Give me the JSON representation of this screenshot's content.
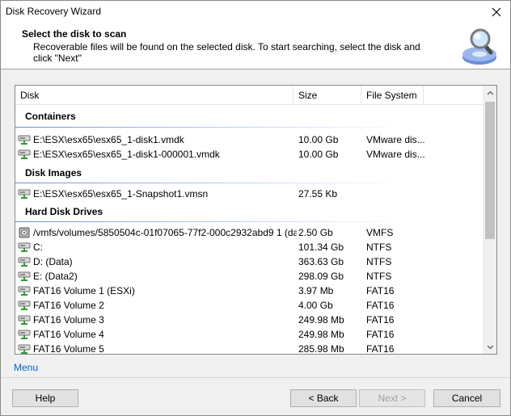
{
  "window": {
    "title": "Disk Recovery Wizard"
  },
  "header": {
    "title": "Select the disk to scan",
    "description": "Recoverable files will be found on the selected disk. To start searching, select the disk and click \"Next\""
  },
  "columns": {
    "disk": "Disk",
    "size": "Size",
    "fs": "File System"
  },
  "groups": {
    "containers": "Containers",
    "images": "Disk Images",
    "drives": "Hard Disk Drives"
  },
  "rows": [
    {
      "name": "E:\\ESX\\esx65\\esx65_1-disk1.vmdk",
      "size": "10.00 Gb",
      "fs": "VMware dis...",
      "icon": "drive-icon"
    },
    {
      "name": "E:\\ESX\\esx65\\esx65_1-disk1-000001.vmdk",
      "size": "10.00 Gb",
      "fs": "VMware dis...",
      "icon": "drive-icon"
    },
    {
      "name": "E:\\ESX\\esx65\\esx65_1-Snapshot1.vmsn",
      "size": "27.55 Kb",
      "fs": "",
      "icon": "drive-icon"
    },
    {
      "name": "/vmfs/volumes/5850504c-01f07065-77f2-000c2932abd9 1 (dat...",
      "size": "2.50 Gb",
      "fs": "VMFS",
      "icon": "hdd-icon"
    },
    {
      "name": "C:",
      "size": "101.34 Gb",
      "fs": "NTFS",
      "icon": "drive-icon"
    },
    {
      "name": "D: (Data)",
      "size": "363.63 Gb",
      "fs": "NTFS",
      "icon": "drive-icon"
    },
    {
      "name": "E: (Data2)",
      "size": "298.09 Gb",
      "fs": "NTFS",
      "icon": "drive-icon"
    },
    {
      "name": "FAT16 Volume 1 (ESXi)",
      "size": "3.97 Mb",
      "fs": "FAT16",
      "icon": "drive-icon"
    },
    {
      "name": "FAT16 Volume 2",
      "size": "4.00 Gb",
      "fs": "FAT16",
      "icon": "drive-icon"
    },
    {
      "name": "FAT16 Volume 3",
      "size": "249.98 Mb",
      "fs": "FAT16",
      "icon": "drive-icon"
    },
    {
      "name": "FAT16 Volume 4",
      "size": "249.98 Mb",
      "fs": "FAT16",
      "icon": "drive-icon"
    },
    {
      "name": "FAT16 Volume 5",
      "size": "285.98 Mb",
      "fs": "FAT16",
      "icon": "drive-icon"
    }
  ],
  "menu_label": "Menu",
  "buttons": {
    "help": "Help",
    "back": "< Back",
    "next": "Next >",
    "cancel": "Cancel"
  },
  "colors": {
    "accent": "#0066cc",
    "group_line": "#6a8fd8"
  }
}
